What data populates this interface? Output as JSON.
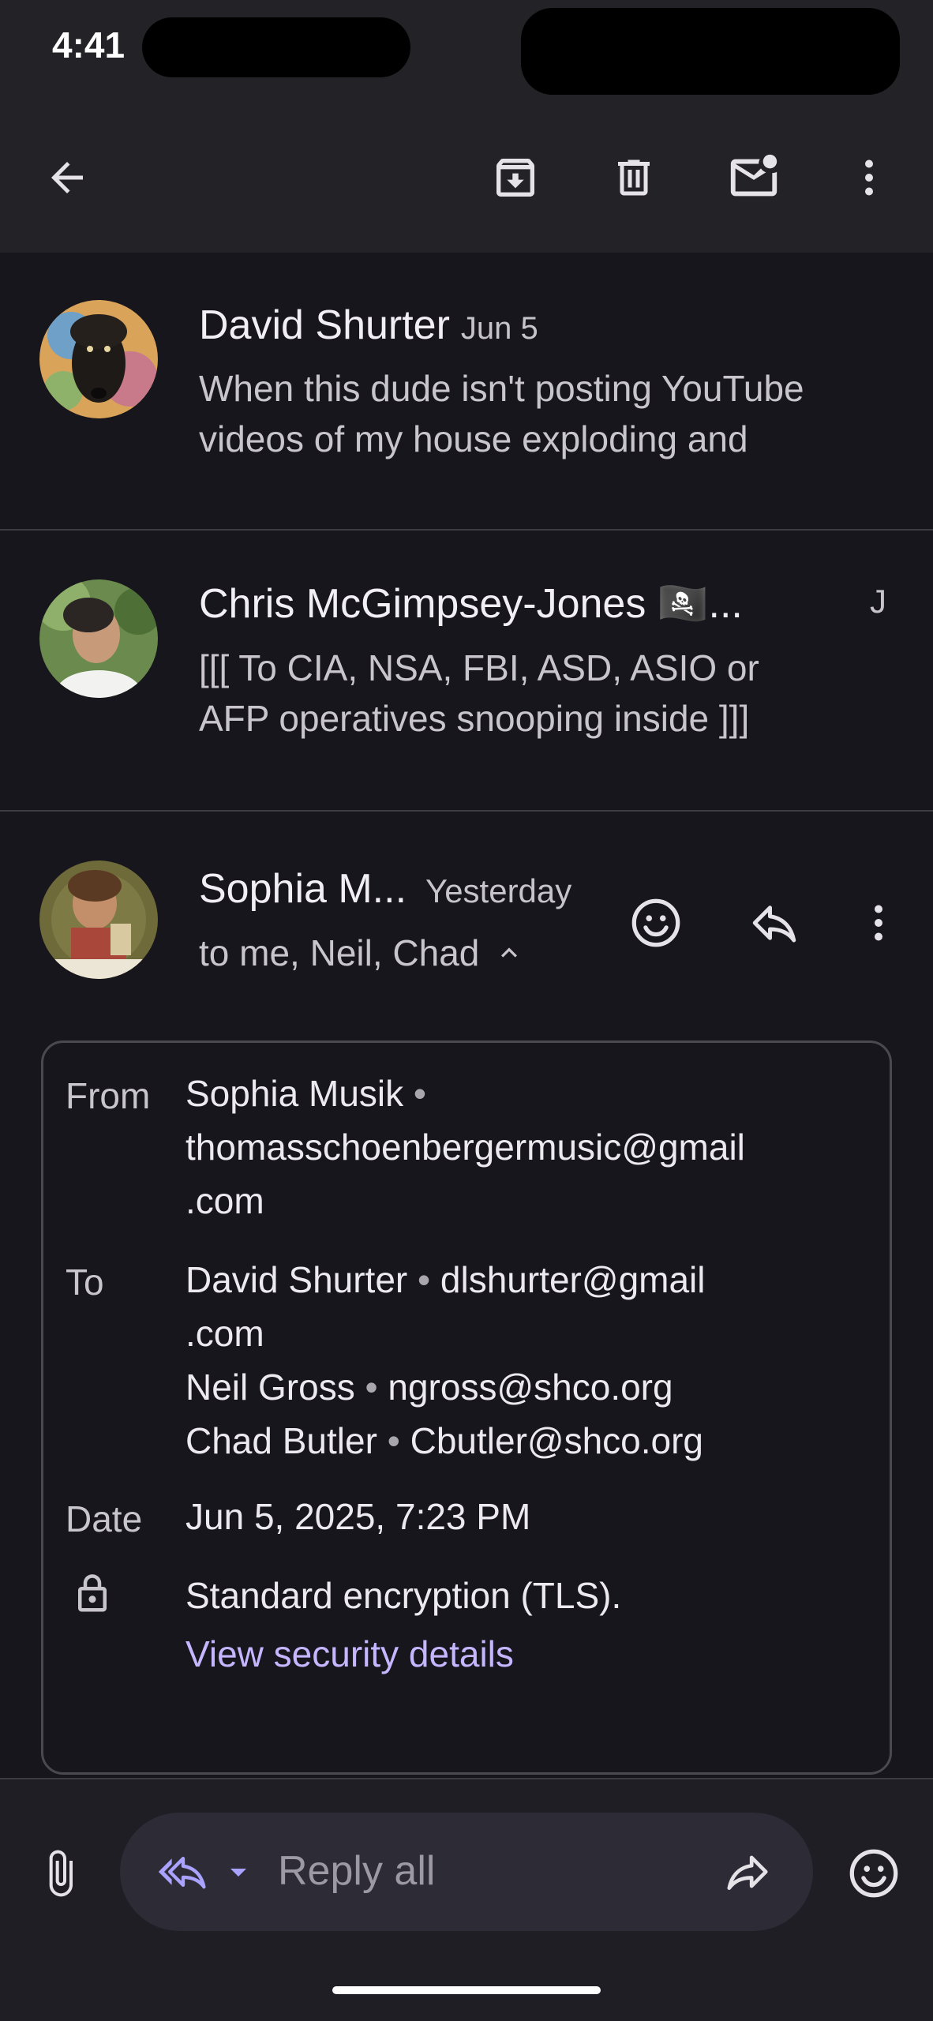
{
  "status_bar": {
    "time": "4:41"
  },
  "toolbar": {
    "back_icon": "arrow-back-icon",
    "archive_icon": "archive-icon",
    "delete_icon": "trash-icon",
    "mark_unread_icon": "mail-unread-icon",
    "more_icon": "more-vert-icon"
  },
  "messages": [
    {
      "sender": "David Shurter",
      "date": "Jun 5",
      "snippet_line1": "When this dude isn't posting YouTube",
      "snippet_line2": "videos of my house exploding and"
    },
    {
      "sender": "Chris McGimpsey-Jones 🏴‍☠️...",
      "date": "J",
      "snippet_line1": "[[[ To CIA, NSA, FBI, ASD, ASIO or",
      "snippet_line2": "AFP operatives snooping inside ]]]"
    }
  ],
  "open_message": {
    "sender": "Sophia M...",
    "date": "Yesterday",
    "recipients_summary": "to me, Neil, Chad",
    "details": {
      "from_label": "From",
      "from_name": "Sophia Musik",
      "from_email_line1": "thomasschoenbergermusic@gmail",
      "from_email_line2": ".com",
      "to_label": "To",
      "to_1_name": "David Shurter",
      "to_1_email_line1": "dlshurter@gmail",
      "to_1_email_line2": ".com",
      "to_2_name": "Neil Gross",
      "to_2_email": "ngross@shco.org",
      "to_3_name": "Chad Butler",
      "to_3_email": "Cbutler@shco.org",
      "date_label": "Date",
      "date_value": "Jun 5, 2025, 7:23 PM",
      "encryption": "Standard encryption (TLS).",
      "security_link": "View security details"
    }
  },
  "reply_bar": {
    "placeholder": "Reply all",
    "attach_icon": "paperclip-icon",
    "reply_all_icon": "reply-all-icon",
    "forward_icon": "forward-icon",
    "emoji_icon": "emoji-icon"
  },
  "colors": {
    "background": "#17161c",
    "toolbar": "#232227",
    "link": "#c6b6ff",
    "accent": "#a9a2ff"
  }
}
